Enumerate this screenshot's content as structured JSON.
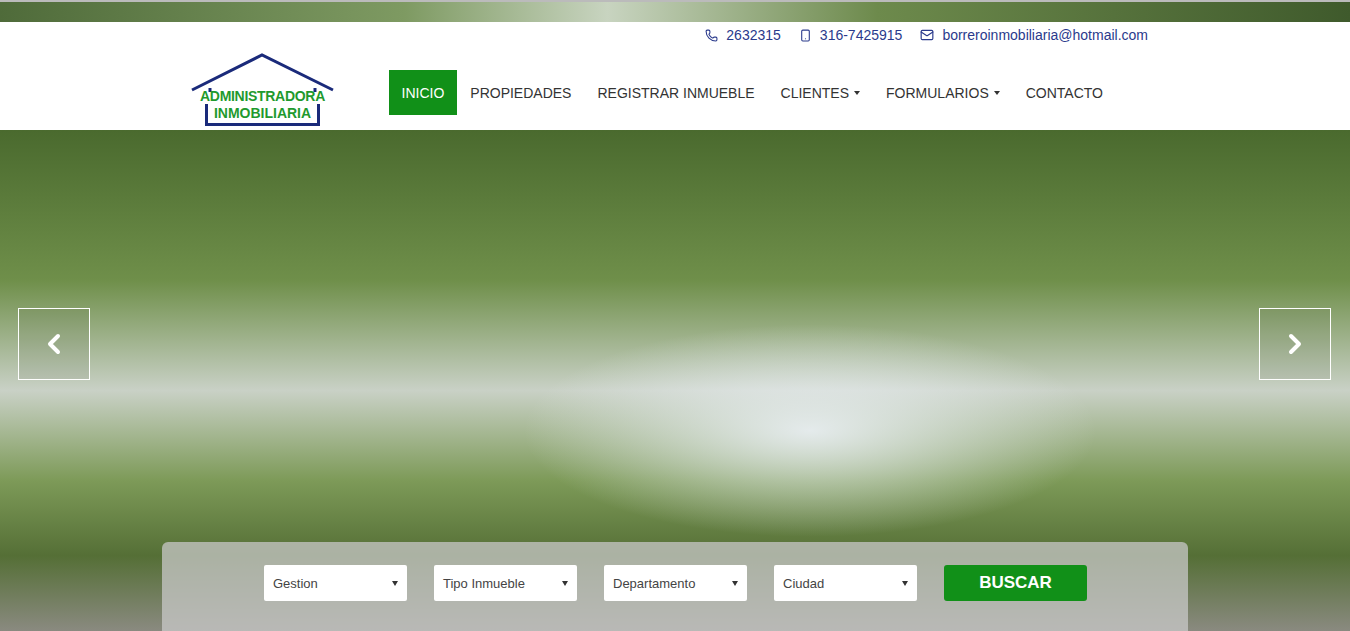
{
  "header": {
    "contacts": [
      {
        "kind": "phone",
        "text": "2632315"
      },
      {
        "kind": "mobile",
        "text": "316-7425915"
      },
      {
        "kind": "email",
        "text": "borreroinmobiliaria@hotmail.com"
      }
    ],
    "logo": {
      "line1": "ADMINISTRADORA",
      "line2": "INMOBILIARIA"
    },
    "nav": [
      {
        "label": "INICIO",
        "selected": true,
        "dropdown": false
      },
      {
        "label": "PROPIEDADES",
        "selected": false,
        "dropdown": false
      },
      {
        "label": "REGISTRAR INMUEBLE",
        "selected": false,
        "dropdown": false
      },
      {
        "label": "CLIENTES",
        "selected": false,
        "dropdown": true
      },
      {
        "label": "FORMULARIOS",
        "selected": false,
        "dropdown": true
      },
      {
        "label": "CONTACTO",
        "selected": false,
        "dropdown": false
      }
    ]
  },
  "search": {
    "selects": [
      {
        "placeholder": "Gestion"
      },
      {
        "placeholder": "Tipo Inmueble"
      },
      {
        "placeholder": "Departamento"
      },
      {
        "placeholder": "Ciudad"
      }
    ],
    "button": "BUSCAR"
  }
}
